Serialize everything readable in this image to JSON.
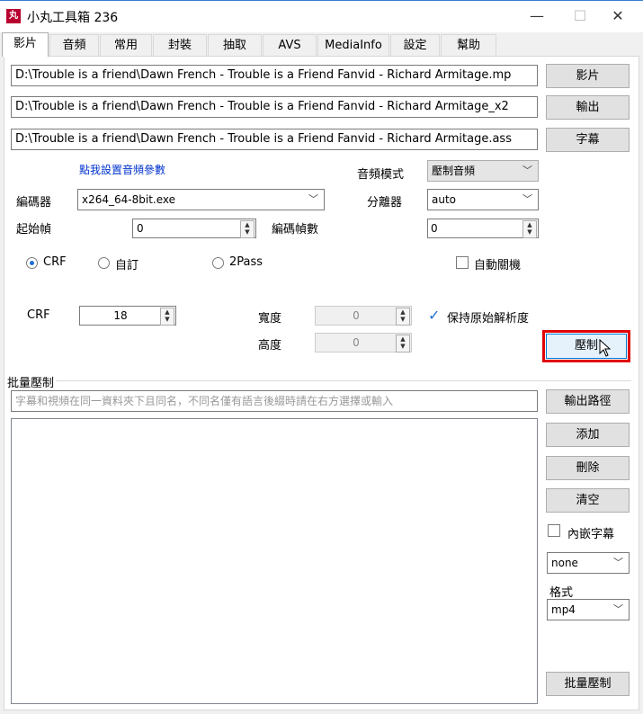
{
  "window": {
    "title": "小丸工具箱 236",
    "app_icon": "丸",
    "minimize": "—",
    "maximize": "☐",
    "close": "✕"
  },
  "tabs": [
    "影片",
    "音頻",
    "常用",
    "封裝",
    "抽取",
    "AVS",
    "MediaInfo",
    "設定",
    "幫助"
  ],
  "paths": {
    "video": "D:\\Trouble is a friend\\Dawn French - Trouble is a Friend Fanvid - Richard Armitage.mp",
    "output": "D:\\Trouble is a friend\\Dawn French - Trouble is a Friend Fanvid - Richard Armitage_x2",
    "subtitle": "D:\\Trouble is a friend\\Dawn French - Trouble is a Friend Fanvid - Richard Armitage.ass"
  },
  "buttons": {
    "video": "影片",
    "output": "輸出",
    "subtitle": "字幕",
    "encode": "壓制",
    "output_path": "輸出路徑",
    "add": "添加",
    "delete": "刪除",
    "clear": "清空",
    "batch_encode": "批量壓制"
  },
  "audio_link": "點我設置音頻參數",
  "labels": {
    "audio_mode": "音頻模式",
    "encoder": "編碼器",
    "splitter": "分離器",
    "start_frame": "起始幀",
    "encode_frames": "編碼幀數",
    "crf": "CRF",
    "width": "寬度",
    "height": "高度",
    "keep_res": "保持原始解析度",
    "auto_shutdown": "自動關機",
    "batch": "批量壓制",
    "embed_sub": "內嵌字幕",
    "format": "格式"
  },
  "values": {
    "audio_mode": "壓制音頻",
    "encoder": "x264_64-8bit.exe",
    "splitter": "auto",
    "start_frame": "0",
    "encode_frames": "0",
    "crf": "18",
    "width": "0",
    "height": "0",
    "subtitle_select": "none",
    "format": "mp4"
  },
  "radios": {
    "crf": "CRF",
    "custom": "自訂",
    "twopass": "2Pass"
  },
  "batch_hint": "字幕和視頻在同一資料夾下且同名，不同名僅有語言後綴時請在右方選擇或輸入",
  "colors": {
    "link": "#0033cc",
    "highlight": "#e00000",
    "check": "#1f6fd1"
  }
}
